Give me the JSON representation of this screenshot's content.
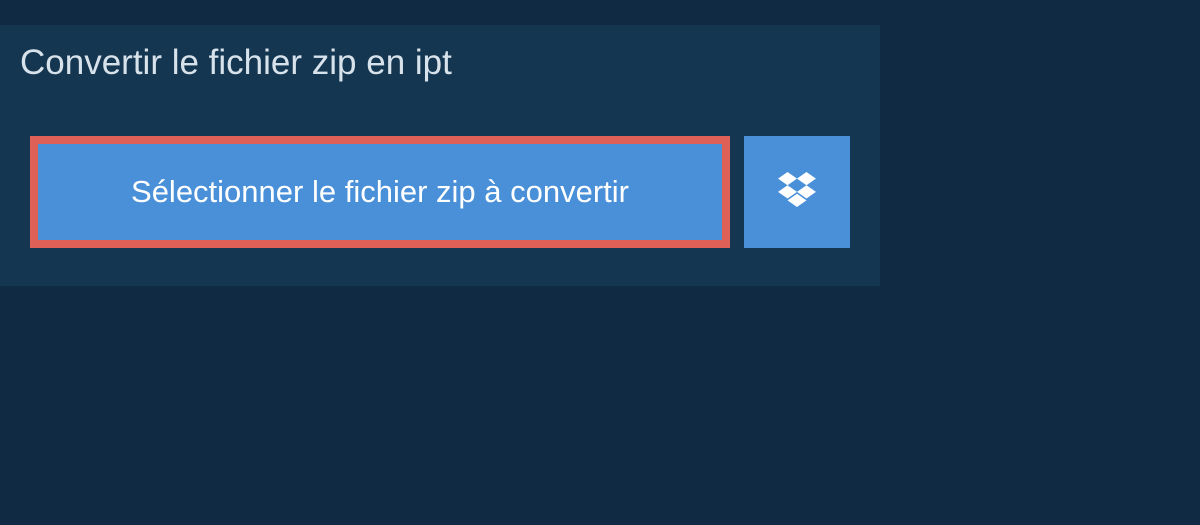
{
  "header": {
    "title": "Convertir le fichier zip en ipt"
  },
  "actions": {
    "select_file_label": "Sélectionner le fichier zip à convertir"
  },
  "colors": {
    "bg_outer": "#0f2a42",
    "bg_panel": "#143651",
    "button_bg": "#4990d9",
    "highlight_border": "#de6057",
    "text_light": "#d8e2eb"
  }
}
